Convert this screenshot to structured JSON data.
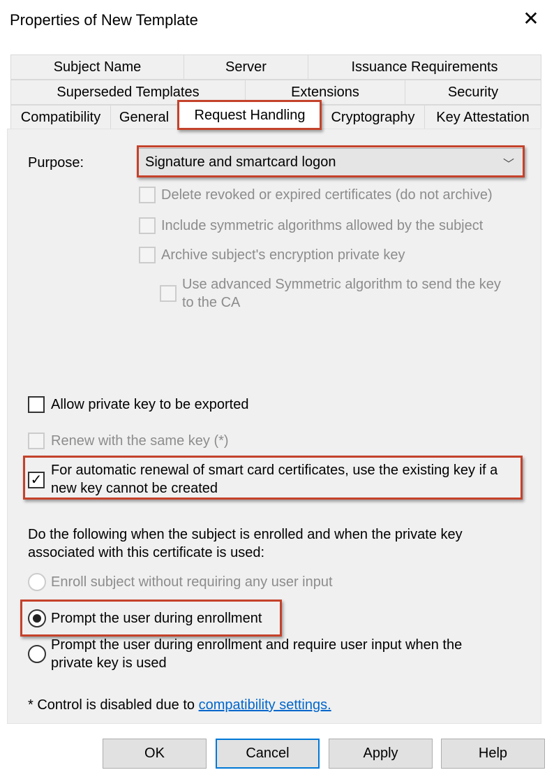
{
  "window": {
    "title": "Properties of New Template",
    "close_icon": "close-icon"
  },
  "tabs": {
    "row1": [
      "Subject Name",
      "Server",
      "Issuance Requirements"
    ],
    "row2": [
      "Superseded Templates",
      "Extensions",
      "Security"
    ],
    "row3": [
      "Compatibility",
      "General",
      "Request Handling",
      "Cryptography",
      "Key Attestation"
    ],
    "selected": "Request Handling"
  },
  "purpose": {
    "label": "Purpose:",
    "value": "Signature and smartcard logon"
  },
  "options": {
    "delete_revoked": {
      "label": "Delete revoked or expired certificates (do not archive)",
      "checked": false,
      "disabled": true
    },
    "include_symmetric": {
      "label": "Include symmetric algorithms allowed by the subject",
      "checked": false,
      "disabled": true
    },
    "archive_key": {
      "label": "Archive subject's encryption private key",
      "checked": false,
      "disabled": true
    },
    "advanced_symmetric": {
      "label1": "Use advanced Symmetric algorithm to send the key",
      "label2": "to the CA",
      "checked": false,
      "disabled": true
    },
    "allow_export": {
      "label": "Allow private key to be exported",
      "checked": false,
      "disabled": false
    },
    "renew_same_key": {
      "label": "Renew with the same key (*)",
      "checked": false,
      "disabled": true
    },
    "auto_renewal": {
      "label1": "For automatic renewal of smart card certificates, use the existing key if a",
      "label2": "new key cannot be created",
      "checked": true,
      "disabled": false
    }
  },
  "enrollment": {
    "description1": "Do the following when the subject is enrolled and when the private key",
    "description2": "associated with this certificate is used:",
    "radios": [
      {
        "label": "Enroll subject without requiring any user input",
        "selected": false,
        "disabled": true
      },
      {
        "label": "Prompt the user during enrollment",
        "selected": true,
        "disabled": false
      },
      {
        "label1": "Prompt the user during enrollment and require user input when the",
        "label2": "private key is used",
        "selected": false,
        "disabled": false
      }
    ]
  },
  "footnote": {
    "text": "* Control is disabled due to ",
    "link": "compatibility settings."
  },
  "buttons": {
    "ok": "OK",
    "cancel": "Cancel",
    "apply": "Apply",
    "help": "Help"
  },
  "colors": {
    "highlight": "#c4422b",
    "link": "#0066cc",
    "default_button_border": "#0078d7"
  }
}
